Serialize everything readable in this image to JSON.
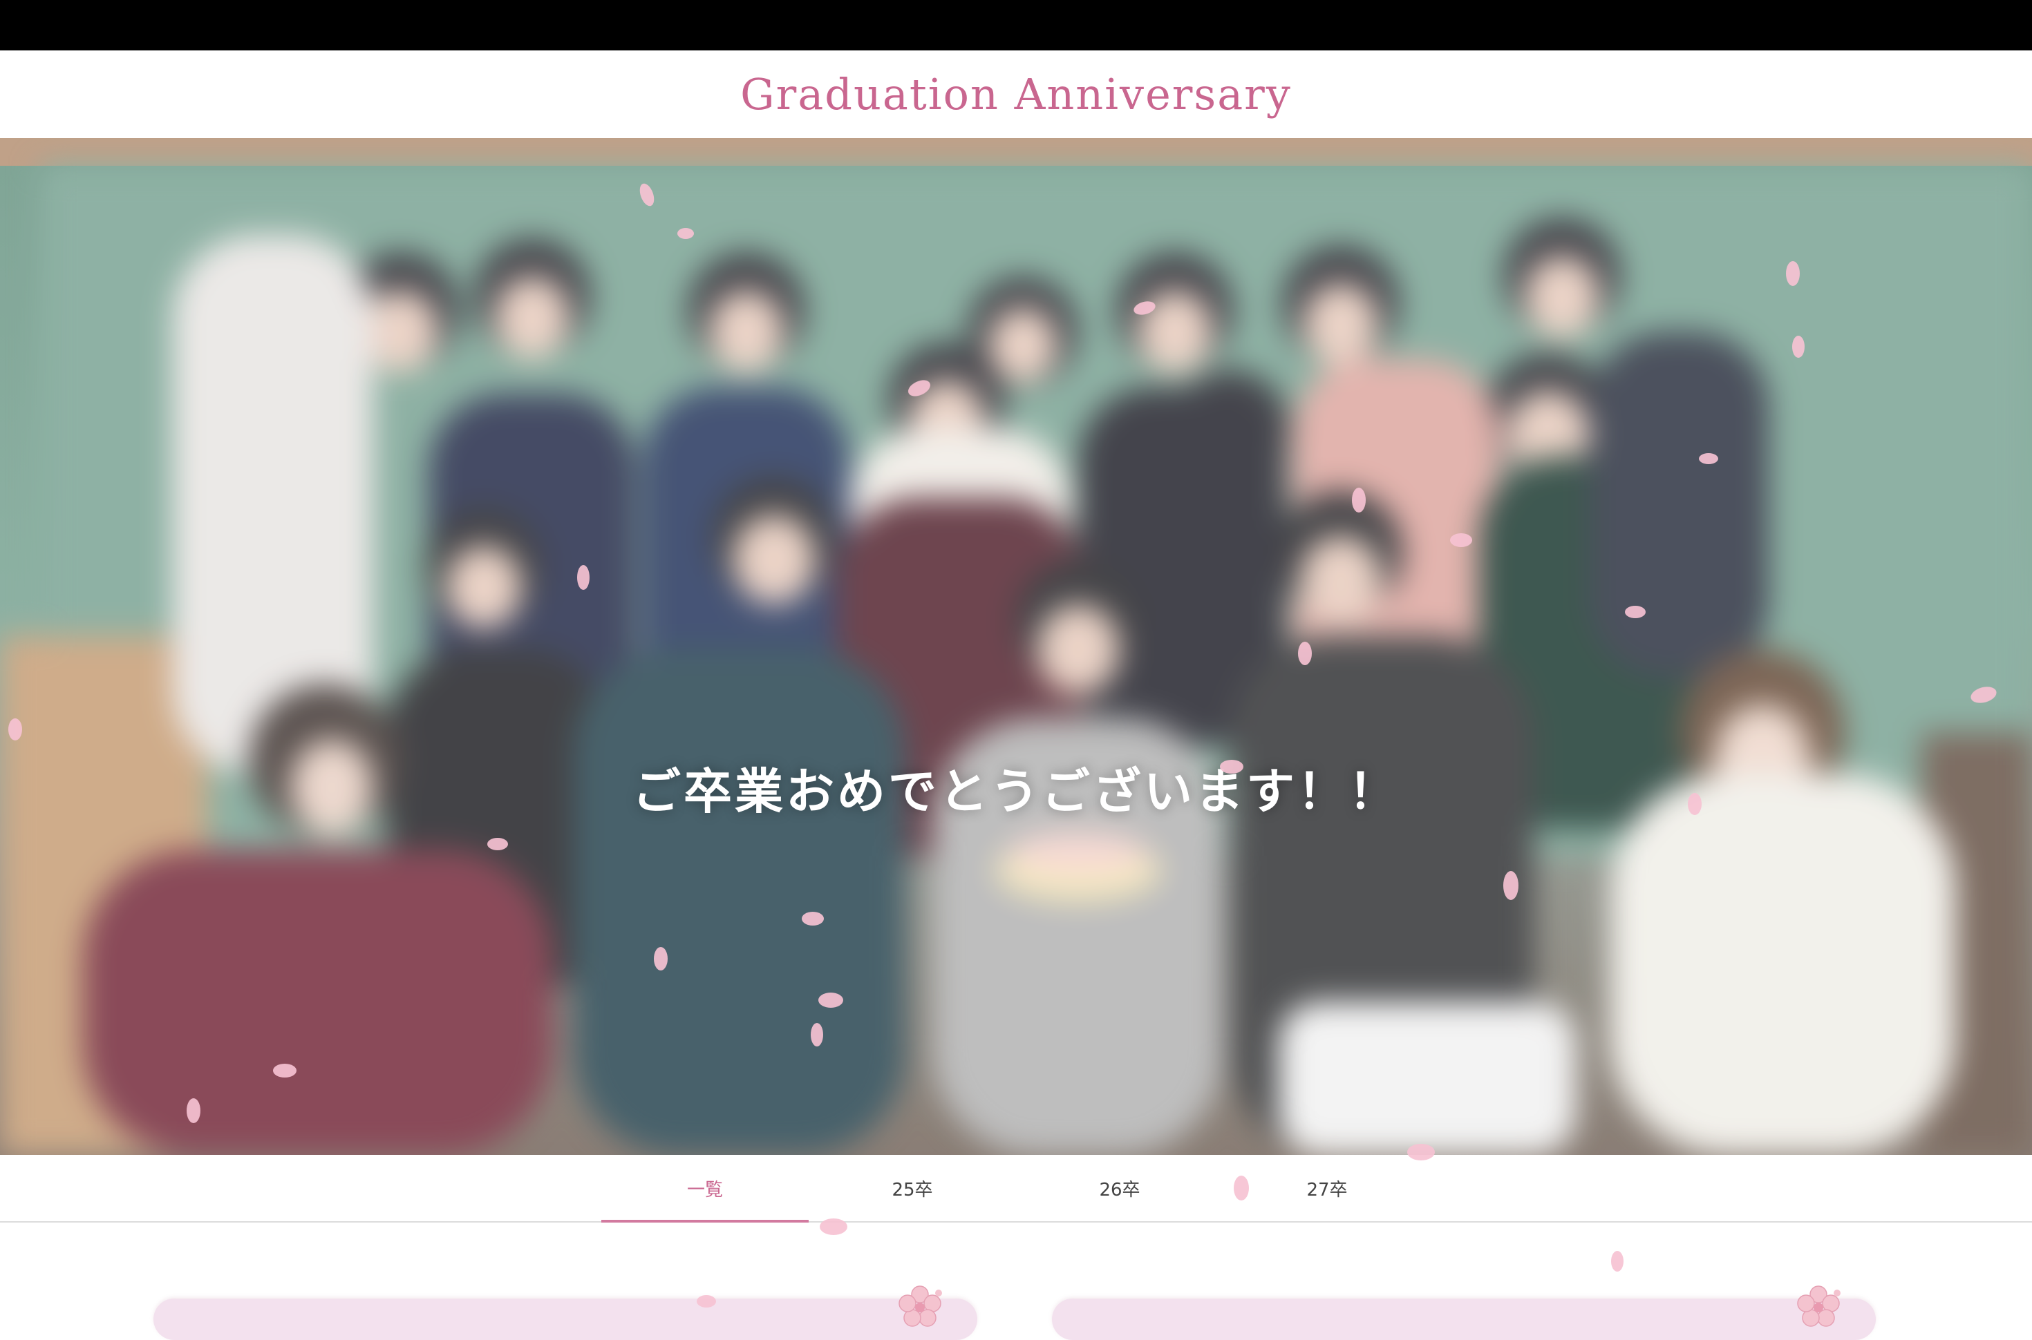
{
  "site": {
    "title": "Graduation Anniversary"
  },
  "hero": {
    "message": "ご卒業おめでとうございます！！",
    "image_alt": "graduation group photo"
  },
  "tabs": [
    {
      "label": "一覧",
      "active": true
    },
    {
      "label": "25卒",
      "active": false
    },
    {
      "label": "26卒",
      "active": false
    },
    {
      "label": "27卒",
      "active": false
    }
  ],
  "colors": {
    "accent": "#c9668f",
    "card_bg": "#f3e1ee",
    "petal": "#f6bfd1"
  },
  "icons": [
    "cherry-blossom-icon",
    "sakura-petal-icon"
  ]
}
